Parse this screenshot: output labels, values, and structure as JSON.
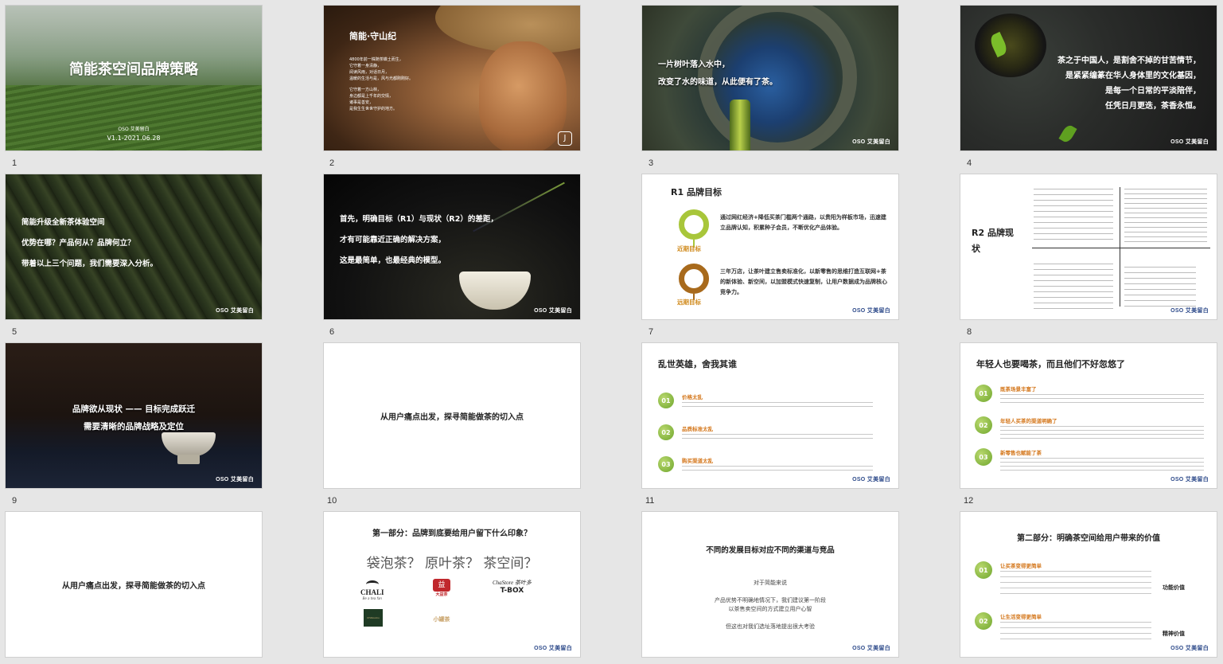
{
  "slides": [
    {
      "num": "1",
      "title": "简能茶空间品牌策略",
      "logo": "OSO 艾美留白",
      "version": "V1.1-2021.06.28"
    },
    {
      "num": "2",
      "heading": "简能·守山纪",
      "lines": [
        "4800年前一株随茶蝶土而生，",
        "它守着一身清静，",
        "阅读风雨，对话日月，",
        "温暖的生活与是，风与光都刚刚好。",
        "",
        "它守着一方山林，",
        "身边都是上千年的交情，",
        "诸事是善安，",
        "是我生生世世守护的地方。"
      ]
    },
    {
      "num": "3",
      "lines": [
        "一片树叶落入水中，",
        "改变了水的味道，从此便有了茶。"
      ],
      "logo": "OSO 艾美留白"
    },
    {
      "num": "4",
      "lines": [
        "茶之于中国人，是割舍不掉的甘苦情节，",
        "是紧紧编篆在华人身体里的文化基因，",
        "是每一个日常的平淡陪伴，",
        "任凭日月更迭，茶香永恒。"
      ],
      "logo": "OSO 艾美留白"
    },
    {
      "num": "5",
      "lines": [
        "简能升级全新茶体验空间",
        "优势在哪？产品何从？品牌何立？",
        "带着以上三个问题，我们需要深入分析。"
      ],
      "logo": "OSO 艾美留白"
    },
    {
      "num": "6",
      "lines": [
        "首先，明确目标（R1）与现状（R2）的差距，",
        "才有可能靠近正确的解决方案，",
        "这是最简单，也最经典的模型。"
      ],
      "logo": "OSO 艾美留白"
    },
    {
      "num": "7",
      "title": "R1 品牌目标",
      "near_label": "近期目标",
      "near_text": "通过网红经济+降低买茶门槛两个通路，以贵阳为样板市场，迅速建立品牌认知，积累种子会员，不断优化产品体验。",
      "far_label": "远期目标",
      "far_text": "三年万店，让茶叶建立售卖标准化，以新零售的思维打造互联网+茶的新体验、新空间，以加盟模式快速复制，让用户数据成为品牌核心竞争力。",
      "logo": "OSO 艾美留白"
    },
    {
      "num": "8",
      "title": "R2 品牌现状",
      "logo": "OSO 艾美留白"
    },
    {
      "num": "9",
      "lines": [
        "品牌欲从现状 —— 目标完成跃迁",
        "需要清晰的品牌战略及定位"
      ],
      "logo": "OSO 艾美留白"
    },
    {
      "num": "10",
      "title": "从用户痛点出发，探寻简能做茶的切入点"
    },
    {
      "num": "11",
      "title": "乱世英雄，舍我其谁",
      "items": [
        {
          "n": "01",
          "h": "价格太乱"
        },
        {
          "n": "02",
          "h": "品质标准太乱"
        },
        {
          "n": "03",
          "h": "购买渠道太乱"
        }
      ],
      "logo": "OSO 艾美留白"
    },
    {
      "num": "12",
      "title": "年轻人也要喝茶，而且他们不好忽悠了",
      "items": [
        {
          "n": "01",
          "h": "既茶场景丰富了"
        },
        {
          "n": "02",
          "h": "年轻人买茶的渠道明确了"
        },
        {
          "n": "03",
          "h": "新零售也赋能了茶"
        }
      ],
      "logo": "OSO 艾美留白"
    },
    {
      "num": "",
      "title": "从用户痛点出发，探寻简能做茶的切入点"
    },
    {
      "num": "",
      "title": "第一部分：品牌到底要给用户留下什么印象？",
      "question": "袋泡茶？ 原叶茶？ 茶空间？",
      "brands": [
        "CHALI",
        "Be a tea fan",
        "大益茶",
        "ChaStore 茶叶多",
        "T-BOX",
        "CHAbiubiu",
        "小罐茶"
      ],
      "logo": "OSO 艾美留白"
    },
    {
      "num": "",
      "title": "不同的发展目标对应不同的渠道与竞品",
      "lines": [
        "对于简能来说",
        "",
        "产品优势不明确地情况下，我们建议第一阶段",
        "以茶售卖空间的方式建立用户心智",
        "",
        "但这也对我们选址落地提出很大考验"
      ],
      "logo": "OSO 艾美留白"
    },
    {
      "num": "",
      "title": "第二部分：明确茶空间给用户带来的价值",
      "items": [
        {
          "n": "01",
          "h": "让买茶变得更简单",
          "tag": "功能价值"
        },
        {
          "n": "02",
          "h": "让生活变得更简单",
          "tag": "精神价值"
        }
      ],
      "logo": "OSO 艾美留白"
    }
  ]
}
